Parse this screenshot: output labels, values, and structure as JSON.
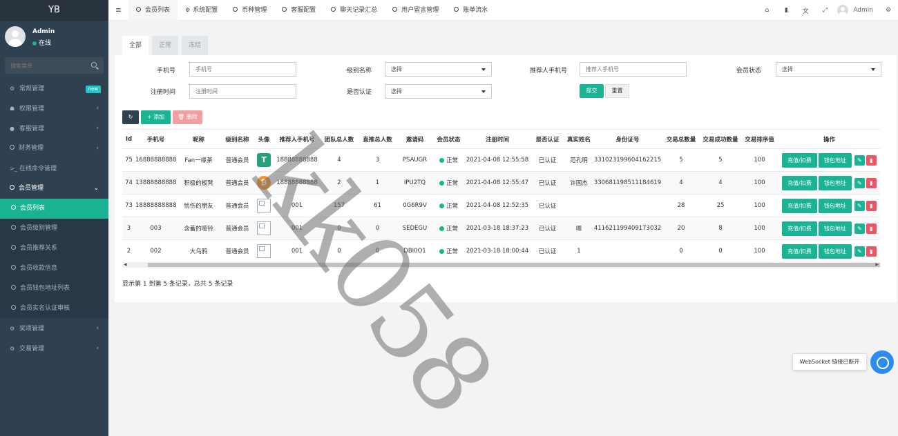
{
  "sidebar": {
    "logo": "YB",
    "user": {
      "name": "Admin",
      "status": "在线"
    },
    "search_placeholder": "搜索菜单",
    "menu": [
      {
        "label": "常规管理",
        "icon": "⚙",
        "badge": "new"
      },
      {
        "label": "权限管理",
        "icon": "👥",
        "arrow": "‹"
      },
      {
        "label": "客服管理",
        "icon": "💬",
        "arrow": "‹"
      },
      {
        "label": "财务管理",
        "icon": "○",
        "arrow": "‹"
      },
      {
        "label": "在线命令管理",
        "icon": ">_"
      },
      {
        "label": "会员管理",
        "icon": "○",
        "arrow": "⌄"
      }
    ],
    "submenu": [
      {
        "label": "会员列表"
      },
      {
        "label": "会员级别管理"
      },
      {
        "label": "会员推荐关系"
      },
      {
        "label": "会员收款信息"
      },
      {
        "label": "会员钱包地址列表"
      },
      {
        "label": "会员实名认证审核"
      }
    ],
    "menu_after": [
      {
        "label": "奖项管理",
        "icon": "⚙",
        "arrow": "‹"
      },
      {
        "label": "交易管理",
        "icon": "⚙",
        "arrow": "‹"
      }
    ]
  },
  "topbar": {
    "tabs": [
      "会员列表",
      "系统配置",
      "币种管理",
      "客服配置",
      "聊天记录汇总",
      "用户留言管理",
      "账单流水"
    ],
    "user": "Admin"
  },
  "filter": {
    "tabs": [
      "全部",
      "正常",
      "冻结"
    ],
    "phone_label": "手机号",
    "phone_placeholder": "手机号",
    "level_label": "级别名称",
    "level_value": "选择",
    "referrer_label": "推荐人手机号",
    "referrer_placeholder": "推荐人手机号",
    "status_label": "会员状态",
    "status_value": "选择",
    "regtime_label": "注册时间",
    "regtime_placeholder": "注册时间",
    "cert_label": "是否认证",
    "cert_value": "选择",
    "submit": "提交",
    "reset": "重置"
  },
  "toolbar": {
    "refresh": "↻",
    "add": "+ 添加",
    "delete": "🗑 删除"
  },
  "table": {
    "headers": [
      "Id",
      "手机号",
      "昵称",
      "级别名称",
      "头像",
      "推荐人手机号",
      "团队总人数",
      "直推总人数",
      "邀请码",
      "会员状态",
      "注册时间",
      "是否认证",
      "真实姓名",
      "身份证号",
      "交易总数量",
      "交易成功数量",
      "交易排序值",
      "操作"
    ],
    "rows": [
      {
        "id": "75",
        "phone": "16888888888",
        "nick": "Fan一缘茶",
        "level": "普通会员",
        "avatar": "usdt",
        "ref": "18888888888",
        "team": "4",
        "direct": "3",
        "code": "PSAUGR",
        "status": "正常",
        "time": "2021-04-08 12:55:58",
        "cert": "已认证",
        "name": "范孔明",
        "idno": "331023199604162215",
        "total": "5",
        "success": "5",
        "sort": "100"
      },
      {
        "id": "74",
        "phone": "13888888888",
        "nick": "积极的板凳",
        "level": "普通会员",
        "avatar": "btc",
        "ref": "18888888888",
        "team": "2",
        "direct": "1",
        "code": "IPU2TQ",
        "status": "正常",
        "time": "2021-04-08 12:55:47",
        "cert": "已认证",
        "name": "许国杰",
        "idno": "330681198511184619",
        "total": "4",
        "success": "4",
        "sort": "100"
      },
      {
        "id": "73",
        "phone": "18888888888",
        "nick": "忧伤的朋友",
        "level": "普通会员",
        "avatar": "broken",
        "ref": "001",
        "team": "157",
        "direct": "61",
        "code": "0G6R9V",
        "status": "正常",
        "time": "2021-04-08 12:52:35",
        "cert": "已认证",
        "name": "",
        "idno": "",
        "total": "28",
        "success": "25",
        "sort": "100"
      },
      {
        "id": "3",
        "phone": "003",
        "nick": "含蓄的哑铃",
        "level": "普通会员",
        "avatar": "broken",
        "ref": "001",
        "team": "0",
        "direct": "0",
        "code": "SEDEGU",
        "status": "正常",
        "time": "2021-03-18 18:37:23",
        "cert": "已认证",
        "name": "嗯",
        "idno": "411621199409173032",
        "total": "20",
        "success": "8",
        "sort": "100"
      },
      {
        "id": "2",
        "phone": "002",
        "nick": "大乌鸦",
        "level": "普通会员",
        "avatar": "broken",
        "ref": "001",
        "team": "0",
        "direct": "0",
        "code": "DBI0O1",
        "status": "正常",
        "time": "2021-03-18 18:00:44",
        "cert": "已认证",
        "name": "1",
        "idno": "",
        "total": "0",
        "success": "0",
        "sort": "100"
      }
    ],
    "op_recharge": "充值/扣费",
    "op_wallet": "钱包地址"
  },
  "pager": "显示第 1 到第 5 条记录，总共 5 条记录",
  "watermark": "kk058",
  "websocket": "WebSocket 链接已断开",
  "colors": {
    "accent": "#1ab394",
    "sidebar": "#2f4050",
    "danger": "#ed5565"
  }
}
